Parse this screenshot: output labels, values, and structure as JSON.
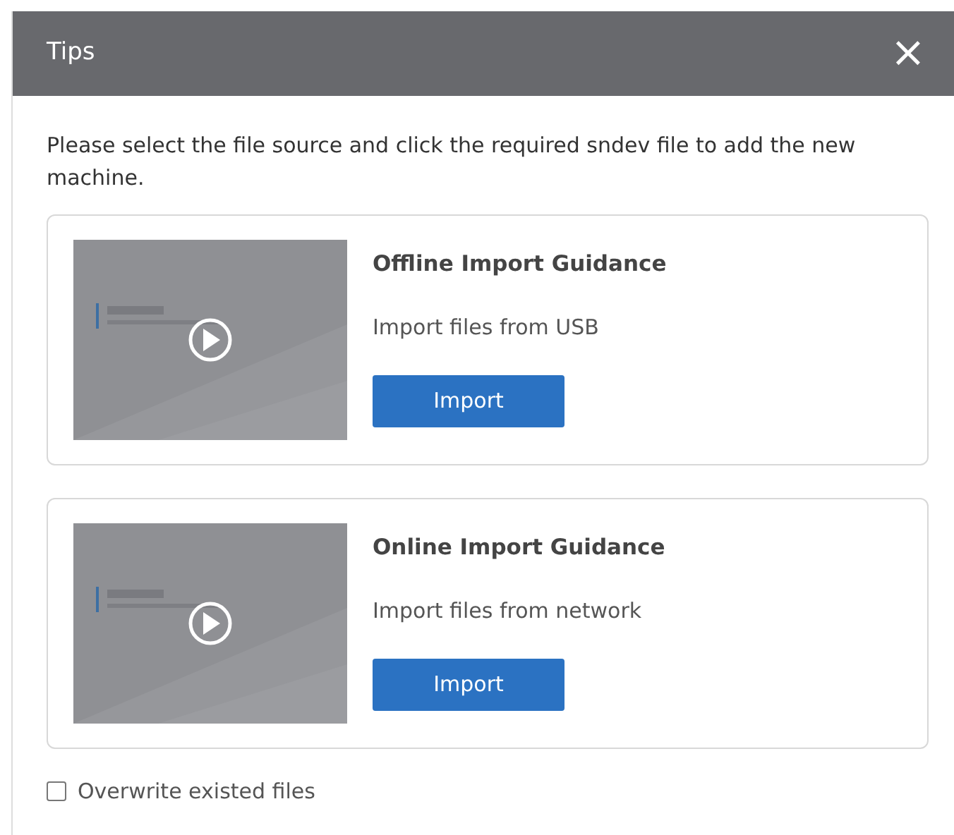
{
  "dialog": {
    "title": "Tips",
    "close": "×"
  },
  "message": "Please select the file source and click the required sndev file to add the new machine.",
  "options": [
    {
      "title": "Offline Import Guidance",
      "description": "Import files from USB",
      "button": "Import"
    },
    {
      "title": "Online Import Guidance",
      "description": "Import files from network",
      "button": "Import"
    }
  ],
  "overwrite": {
    "label": "Overwrite existed files",
    "checked": false
  }
}
